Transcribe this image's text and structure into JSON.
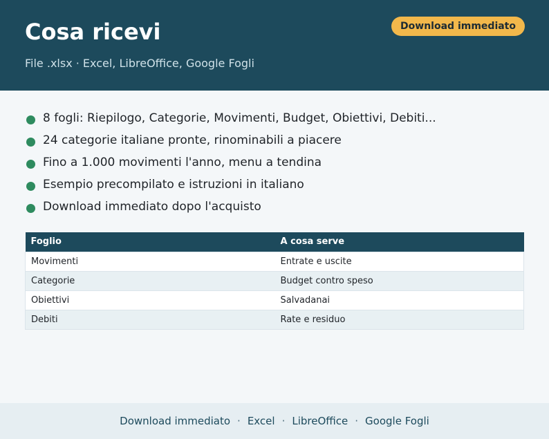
{
  "header": {
    "title": "Cosa ricevi",
    "subtitle": "File .xlsx · Excel, LibreOffice, Google Fogli",
    "cta_label": "Download immediato"
  },
  "colors": {
    "header_bg": "#1d4a5c",
    "accent_button": "#f2b84b",
    "bullet": "#2e8b5f",
    "footer_bg": "#e6eef2"
  },
  "features": [
    "8 fogli: Riepilogo, Categorie, Movimenti, Budget, Obiettivi, Debiti...",
    "24 categorie italiane pronte, rinominabili a piacere",
    "Fino a 1.000 movimenti l'anno, menu a tendina",
    "Esempio precompilato e istruzioni in italiano",
    "Download immediato dopo l'acquisto"
  ],
  "table": {
    "headers": [
      "Foglio",
      "A cosa serve"
    ],
    "rows": [
      [
        "Movimenti",
        "Entrate e uscite"
      ],
      [
        "Categorie",
        "Budget contro speso"
      ],
      [
        "Obiettivi",
        "Salvadanai"
      ],
      [
        "Debiti",
        "Rate e residuo"
      ]
    ]
  },
  "footer": {
    "items": [
      "Download immediato",
      "Excel",
      "LibreOffice",
      "Google Fogli"
    ],
    "separator": "·"
  }
}
